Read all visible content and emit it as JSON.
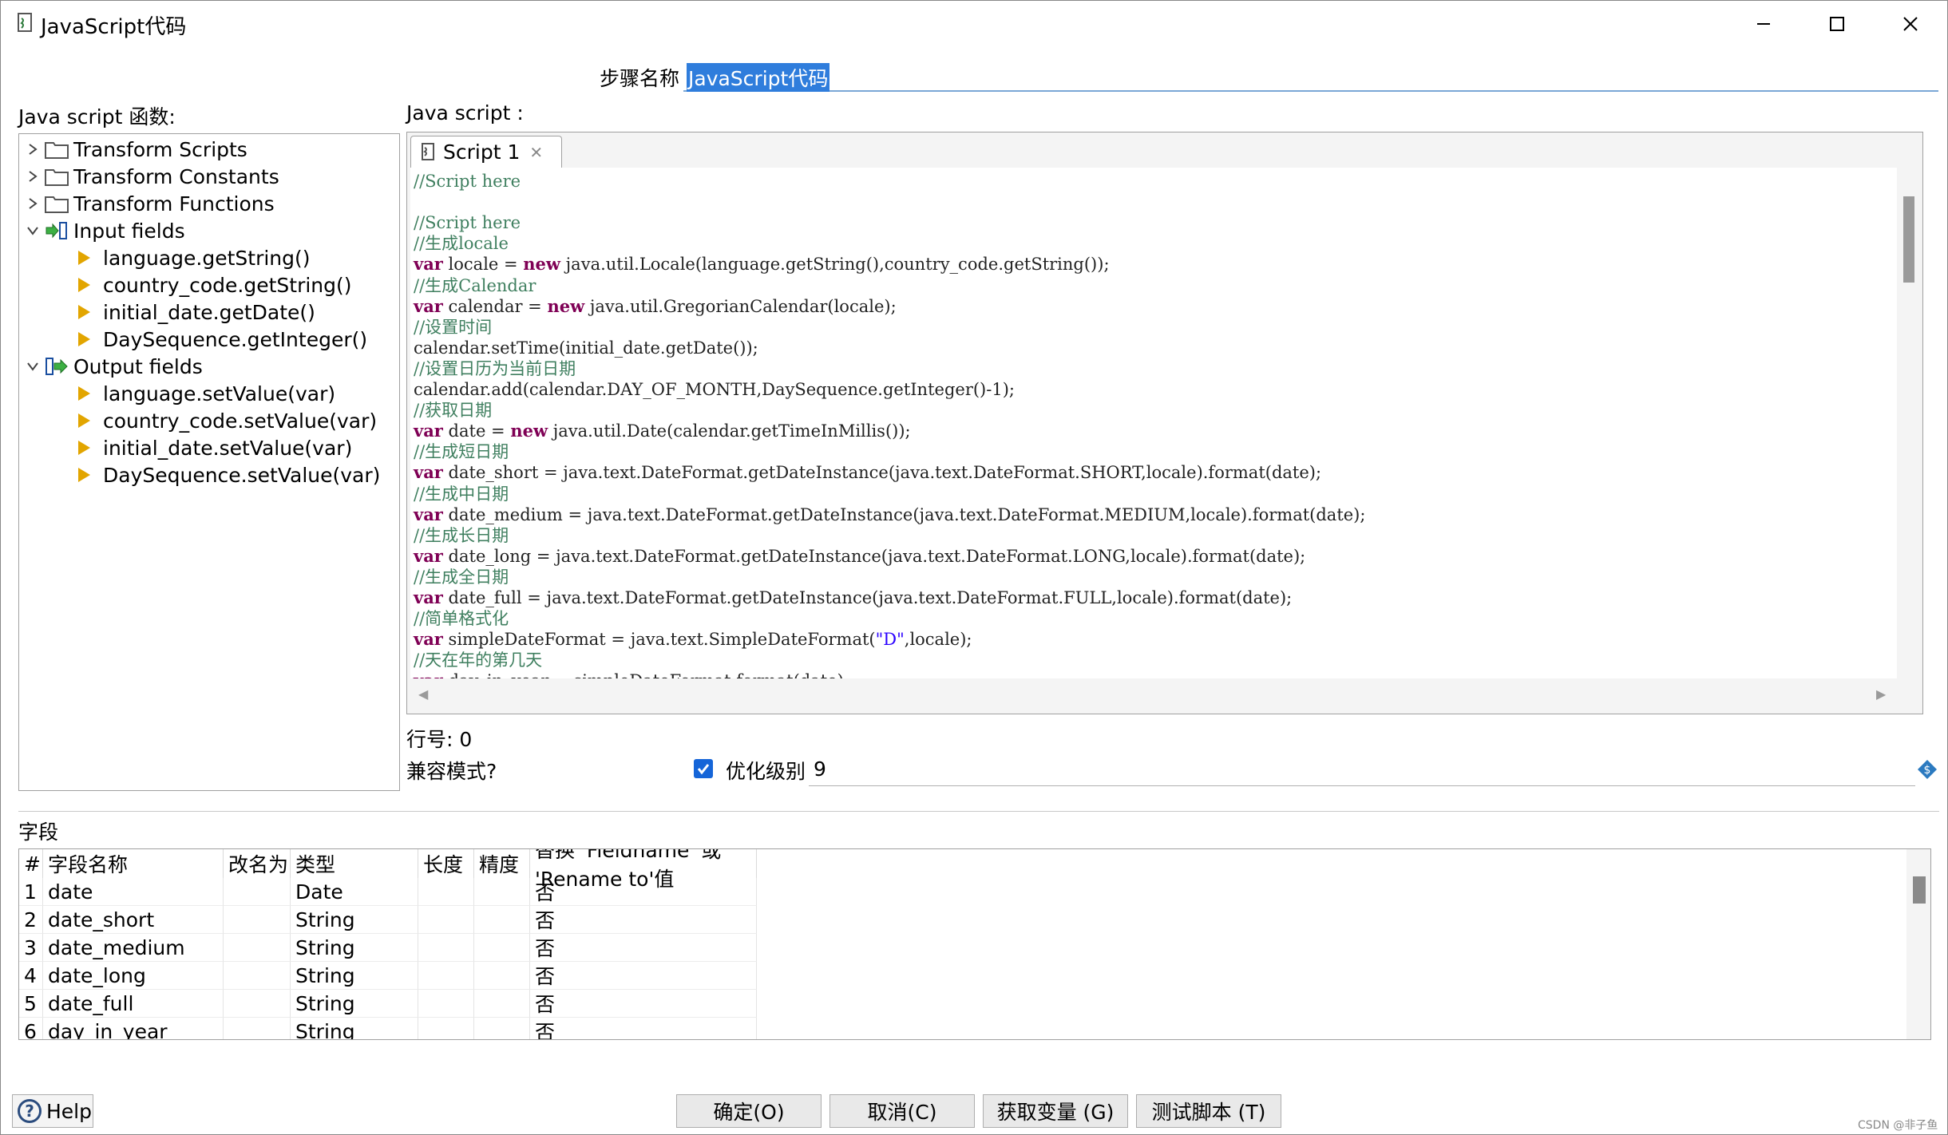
{
  "window": {
    "title": "JavaScript代码",
    "icons": [
      "script-file-icon",
      "minimize-icon",
      "maximize-icon",
      "close-icon"
    ]
  },
  "step": {
    "label": "步骤名称",
    "value": "JavaScript代码"
  },
  "functions_panel": {
    "label": "Java script 函数:",
    "tree": [
      {
        "label": "Transform Scripts",
        "type": "folder",
        "expanded": false
      },
      {
        "label": "Transform Constants",
        "type": "folder",
        "expanded": false
      },
      {
        "label": "Transform Functions",
        "type": "folder",
        "expanded": false
      },
      {
        "label": "Input fields",
        "type": "input",
        "expanded": true,
        "children": [
          "language.getString()",
          "country_code.getString()",
          "initial_date.getDate()",
          "DaySequence.getInteger()"
        ]
      },
      {
        "label": "Output fields",
        "type": "output",
        "expanded": true,
        "children": [
          "language.setValue(var)",
          "country_code.setValue(var)",
          "initial_date.setValue(var)",
          "DaySequence.setValue(var)"
        ]
      }
    ]
  },
  "script_panel": {
    "label": "Java script :",
    "tab_label": "Script 1",
    "code_lines": [
      "//Script here",
      "",
      "//Script here",
      "//生成locale",
      "var locale = new java.util.Locale(language.getString(),country_code.getString());",
      "//生成Calendar",
      "var calendar = new java.util.GregorianCalendar(locale);",
      "//设置时间",
      "calendar.setTime(initial_date.getDate());",
      "//设置日历为当前日期",
      "calendar.add(calendar.DAY_OF_MONTH,DaySequence.getInteger()-1);",
      "//获取日期",
      "var date = new java.util.Date(calendar.getTimeInMillis());",
      "//生成短日期",
      "var date_short = java.text.DateFormat.getDateInstance(java.text.DateFormat.SHORT,locale).format(date);",
      "//生成中日期",
      "var date_medium = java.text.DateFormat.getDateInstance(java.text.DateFormat.MEDIUM,locale).format(date);",
      "//生成长日期",
      "var date_long = java.text.DateFormat.getDateInstance(java.text.DateFormat.LONG,locale).format(date);",
      "//生成全日期",
      "var date_full = java.text.DateFormat.getDateInstance(java.text.DateFormat.FULL,locale).format(date);",
      "//简单格式化",
      "var simpleDateFormat = java.text.SimpleDateFormat(\"D\",locale);",
      "//天在年的第几天",
      "var day_in_year = simpleDateFormat.format(date);"
    ]
  },
  "status": {
    "line_label": "行号: 0",
    "compat_label": "兼容模式?",
    "compat_checked": true,
    "opt_label": "优化级别",
    "opt_value": "9"
  },
  "fields": {
    "label": "字段",
    "columns": [
      "#",
      "字段名称",
      "改名为",
      "类型",
      "长度",
      "精度",
      "替换 'Fieldname' 或 'Rename to'值"
    ],
    "rows": [
      [
        "1",
        "date",
        "",
        "Date",
        "",
        "",
        "否"
      ],
      [
        "2",
        "date_short",
        "",
        "String",
        "",
        "",
        "否"
      ],
      [
        "3",
        "date_medium",
        "",
        "String",
        "",
        "",
        "否"
      ],
      [
        "4",
        "date_long",
        "",
        "String",
        "",
        "",
        "否"
      ],
      [
        "5",
        "date_full",
        "",
        "String",
        "",
        "",
        "否"
      ],
      [
        "6",
        "day_in_year",
        "",
        "String",
        "",
        "",
        "否"
      ]
    ]
  },
  "buttons": {
    "help": "Help",
    "ok": "确定(O)",
    "cancel": "取消(C)",
    "get_vars": "获取变量 (G)",
    "test": "测试脚本 (T)"
  },
  "watermark": "CSDN @非子鱼",
  "colors": {
    "accent": "#2f7ddc",
    "comment": "#3f7f5f",
    "keyword": "#7f0055",
    "string": "#2a00ff",
    "tree_arrow": "#e2a500"
  }
}
